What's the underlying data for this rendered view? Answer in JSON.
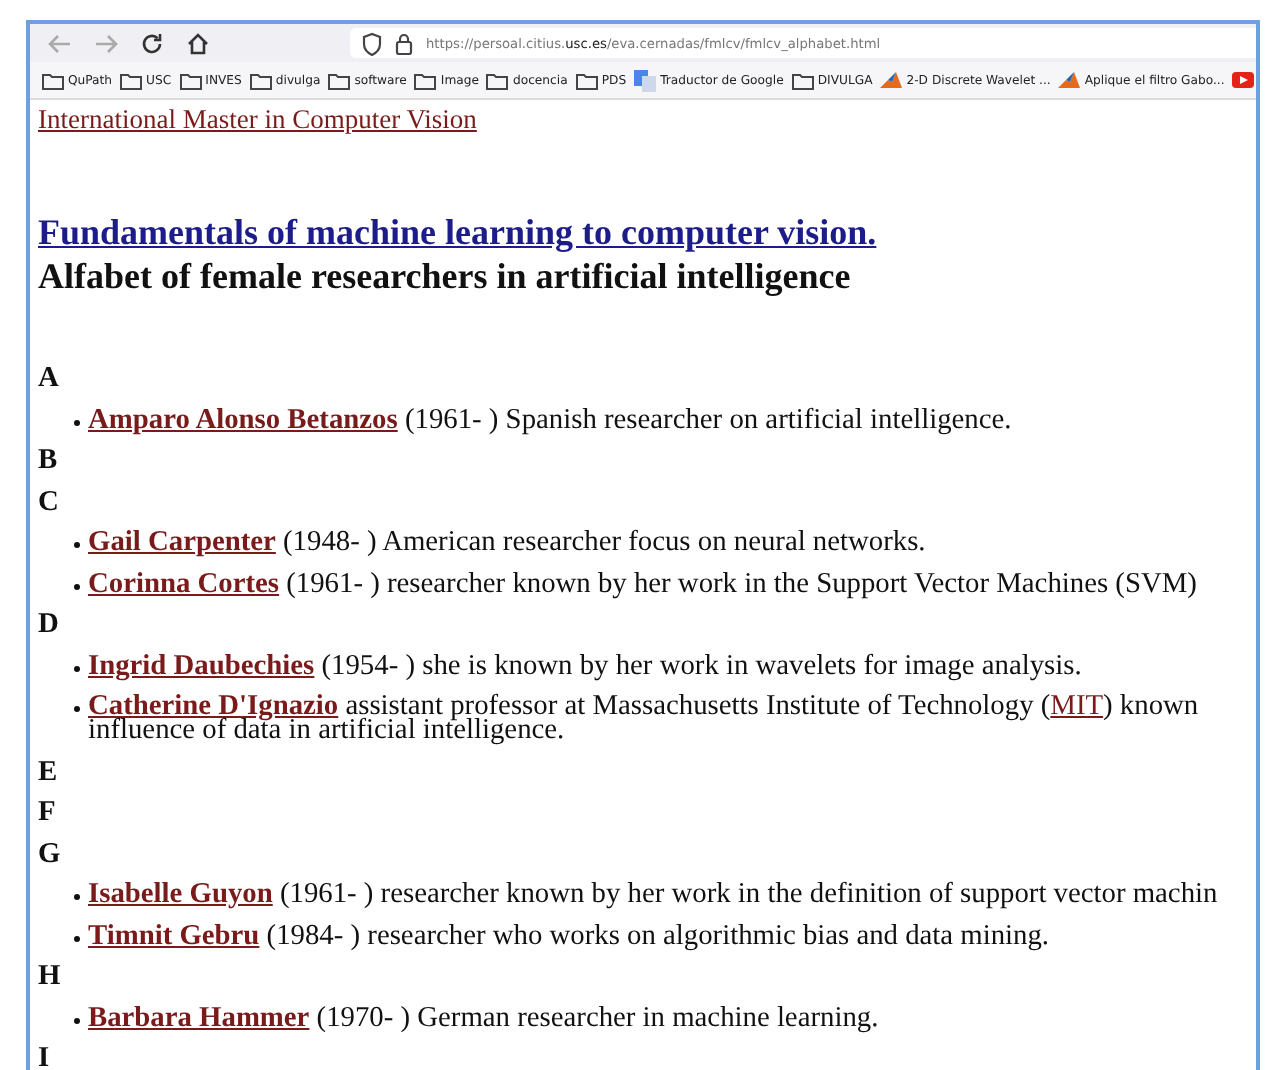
{
  "browser": {
    "url": [
      {
        "text": "https://persoal.citius.",
        "strong": false
      },
      {
        "text": "usc.es",
        "strong": true
      },
      {
        "text": "/eva.cernadas/fmlcv/fmlcv_alphabet.html",
        "strong": false
      }
    ],
    "bookmarks": [
      {
        "kind": "folder",
        "label": "QuPath"
      },
      {
        "kind": "folder",
        "label": "USC"
      },
      {
        "kind": "folder",
        "label": "INVES"
      },
      {
        "kind": "folder",
        "label": "divulga"
      },
      {
        "kind": "folder",
        "label": "software"
      },
      {
        "kind": "folder",
        "label": "Image"
      },
      {
        "kind": "folder",
        "label": "docencia"
      },
      {
        "kind": "folder",
        "label": "PDS"
      },
      {
        "kind": "translate",
        "label": "Traductor de Google"
      },
      {
        "kind": "folder",
        "label": "DIVULGA"
      },
      {
        "kind": "peak",
        "label": "2-D Discrete Wavelet ..."
      },
      {
        "kind": "peak",
        "label": "Aplique el filtro Gabo..."
      },
      {
        "kind": "video"
      }
    ]
  },
  "page": {
    "top_link": "International Master in Computer Vision",
    "heading": "Fundamentals of machine learning to computer vision.",
    "subtitle": "Alfabet of female researchers in artificial intelligence",
    "sections": [
      {
        "letter": "A",
        "entries": [
          {
            "name": "Amparo Alonso Betanzos",
            "lines": [
              [
                {
                  "text": " (1961- ) Spanish researcher on artificial intelligence."
                }
              ]
            ]
          }
        ]
      },
      {
        "letter": "B"
      },
      {
        "letter": "C",
        "entries": [
          {
            "name": "Gail Carpenter",
            "lines": [
              [
                {
                  "text": " (1948- ) American researcher focus on neural networks."
                }
              ]
            ]
          },
          {
            "name": "Corinna Cortes",
            "lines": [
              [
                {
                  "text": " (1961- ) researcher known by her work in the Support Vector Machines (SVM)"
                }
              ]
            ]
          }
        ]
      },
      {
        "letter": "D",
        "entries": [
          {
            "name": "Ingrid Daubechies",
            "lines": [
              [
                {
                  "text": " (1954- ) she is known by her work in wavelets for image analysis."
                }
              ]
            ]
          },
          {
            "name": "Catherine D'Ignazio",
            "lines": [
              [
                {
                  "text": " assistant professor at Massachusetts Institute of Technology ("
                },
                {
                  "text": "MIT",
                  "link": true
                },
                {
                  "text": ") known"
                }
              ],
              [
                {
                  "text": "influence of data in artificial intelligence."
                }
              ]
            ]
          }
        ]
      },
      {
        "letter": "E"
      },
      {
        "letter": "F"
      },
      {
        "letter": "G",
        "entries": [
          {
            "name": "Isabelle Guyon",
            "lines": [
              [
                {
                  "text": " (1961- ) researcher known by her work in the definition of support vector machin"
                }
              ]
            ]
          },
          {
            "name": "Timnit Gebru",
            "lines": [
              [
                {
                  "text": " (1984- ) researcher who works on algorithmic bias and data mining."
                }
              ]
            ]
          }
        ]
      },
      {
        "letter": "H",
        "entries": [
          {
            "name": "Barbara Hammer",
            "lines": [
              [
                {
                  "text": " (1970- ) German researcher in machine learning."
                }
              ]
            ]
          }
        ]
      },
      {
        "letter": "I"
      }
    ]
  }
}
